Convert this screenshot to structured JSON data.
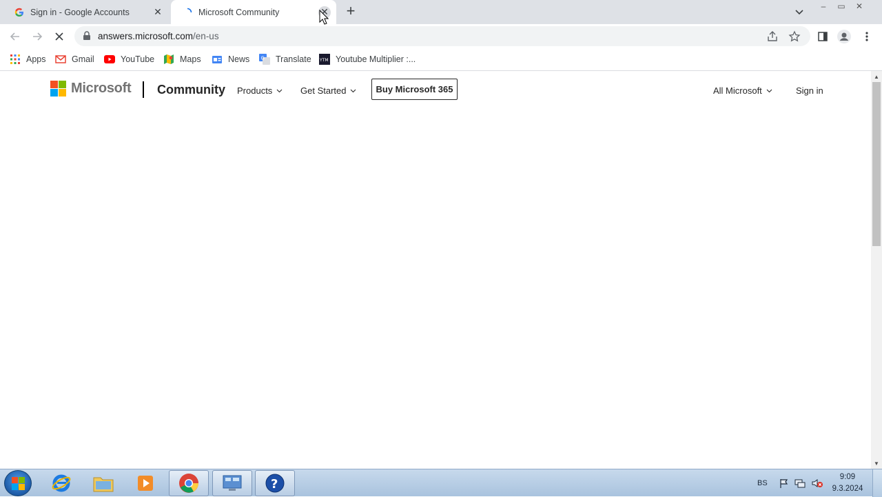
{
  "browser": {
    "tabs": [
      {
        "title": "Sign in - Google Accounts",
        "active": false,
        "favicon": "google-g-icon"
      },
      {
        "title": "Microsoft Community",
        "active": true,
        "favicon": "loading-spinner-icon"
      }
    ],
    "new_tab_label": "+",
    "window_controls": {
      "minimize": "–",
      "restore": "▭",
      "close": "✕"
    },
    "address": {
      "host": "answers.microsoft.com",
      "path": "/en-us"
    },
    "bookmarks": [
      {
        "label": "Apps",
        "icon": "apps-grid-icon"
      },
      {
        "label": "Gmail",
        "icon": "gmail-icon"
      },
      {
        "label": "YouTube",
        "icon": "youtube-icon"
      },
      {
        "label": "Maps",
        "icon": "maps-icon"
      },
      {
        "label": "News",
        "icon": "news-icon"
      },
      {
        "label": "Translate",
        "icon": "translate-icon"
      },
      {
        "label": "Youtube Multiplier :...",
        "icon": "ytm-icon"
      }
    ]
  },
  "site": {
    "brand": "Microsoft",
    "section": "Community",
    "nav": [
      {
        "label": "Products",
        "chevron": "⌵"
      },
      {
        "label": "Get Started",
        "chevron": "⌵"
      }
    ],
    "buy_button": "Buy Microsoft 365",
    "all_microsoft": {
      "label": "All Microsoft",
      "chevron": "⌵"
    },
    "sign_in": "Sign in",
    "logo_colors": [
      "#f25022",
      "#7fba00",
      "#00a4ef",
      "#ffb900"
    ]
  },
  "taskbar": {
    "apps": [
      "internet-explorer-icon",
      "file-explorer-icon",
      "media-player-icon",
      "chrome-icon",
      "control-panel-icon",
      "help-icon"
    ],
    "tray_language": "BS",
    "clock_time": "9:09",
    "clock_date": "9.3.2024"
  }
}
